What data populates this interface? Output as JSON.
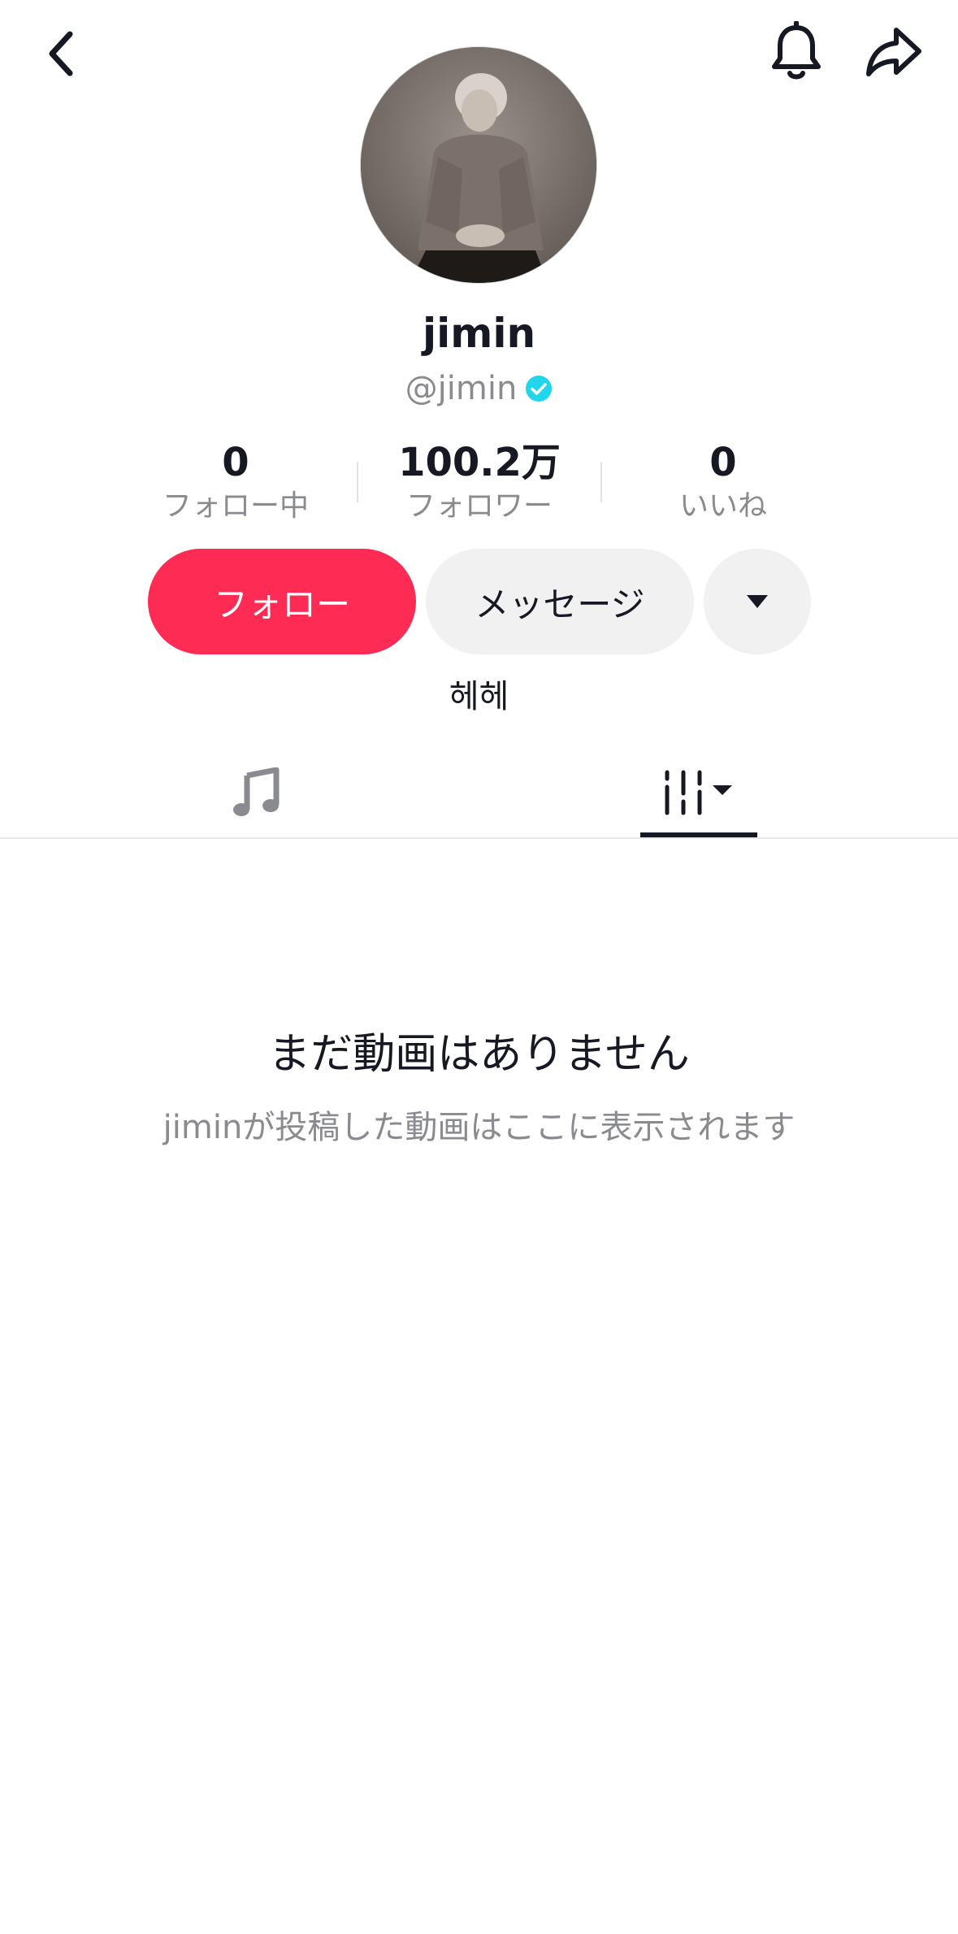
{
  "profile": {
    "display_name": "jimin",
    "handle": "@jimin",
    "verified": true,
    "bio": "헤헤"
  },
  "stats": [
    {
      "value": "0",
      "label": "フォロー中"
    },
    {
      "value": "100.2万",
      "label": "フォロワー"
    },
    {
      "value": "0",
      "label": "いいね"
    }
  ],
  "actions": {
    "follow_label": "フォロー",
    "message_label": "メッセージ"
  },
  "tabs": [
    {
      "icon": "music-note-icon"
    },
    {
      "icon": "grid-filter-icon",
      "selected": true
    }
  ],
  "empty_state": {
    "title": "まだ動画はありません",
    "subtitle": "jiminが投稿した動画はここに表示されます"
  },
  "icons": {
    "back": "back-chevron-icon",
    "bell": "bell-icon",
    "share": "share-arrow-icon",
    "dropdown": "caret-down-icon"
  },
  "colors": {
    "accent": "#fe2c55",
    "verified": "#20d5ec",
    "secondary_text": "#8a8b91",
    "button_gray": "#f1f1f2"
  }
}
